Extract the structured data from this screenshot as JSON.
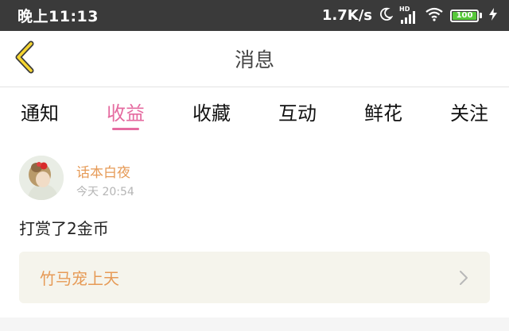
{
  "status_bar": {
    "time": "晚上11:13",
    "net_speed": "1.7K/s",
    "signal_label": "HD",
    "battery": "100",
    "battery_percent": 100
  },
  "nav": {
    "title": "消息",
    "back_icon": "chevron-left-icon"
  },
  "tabs": [
    {
      "label": "通知",
      "active": false
    },
    {
      "label": "收益",
      "active": true
    },
    {
      "label": "收藏",
      "active": false
    },
    {
      "label": "互动",
      "active": false
    },
    {
      "label": "鲜花",
      "active": false
    },
    {
      "label": "关注",
      "active": false
    }
  ],
  "message": {
    "sender": "话本白夜",
    "time": "今天 20:54",
    "text": "打赏了2金币",
    "book_title": "竹马宠上天"
  },
  "colors": {
    "accent": "#e56ba0",
    "name_orange": "#e69a56",
    "back_yellow": "#f5d531",
    "status_bar_bg": "#3a3a3a",
    "card_bg": "#f5f4ec"
  }
}
